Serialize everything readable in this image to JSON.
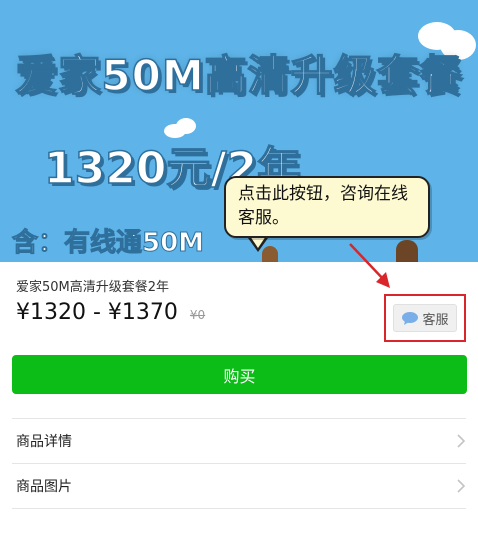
{
  "banner": {
    "title": "爱家50M高清升级套餐",
    "price": "1320元/2年",
    "includes": "含：有线通50M",
    "bg_color": "#5eb4e8"
  },
  "callout": {
    "text": "点击此按钮，咨询在线客服。"
  },
  "product": {
    "title": "爱家50M高清升级套餐2年",
    "price_range": "¥1320 - ¥1370",
    "original_price": "¥0"
  },
  "service_button": {
    "label": "客服",
    "icon": "chat-bubble-icon"
  },
  "buy_button": {
    "label": "购买",
    "color": "#0bbd16"
  },
  "list": {
    "items": [
      {
        "label": "商品详情",
        "icon": "chevron-right-icon"
      },
      {
        "label": "商品图片",
        "icon": "chevron-right-icon"
      }
    ]
  },
  "highlight_color": "#d9262a"
}
